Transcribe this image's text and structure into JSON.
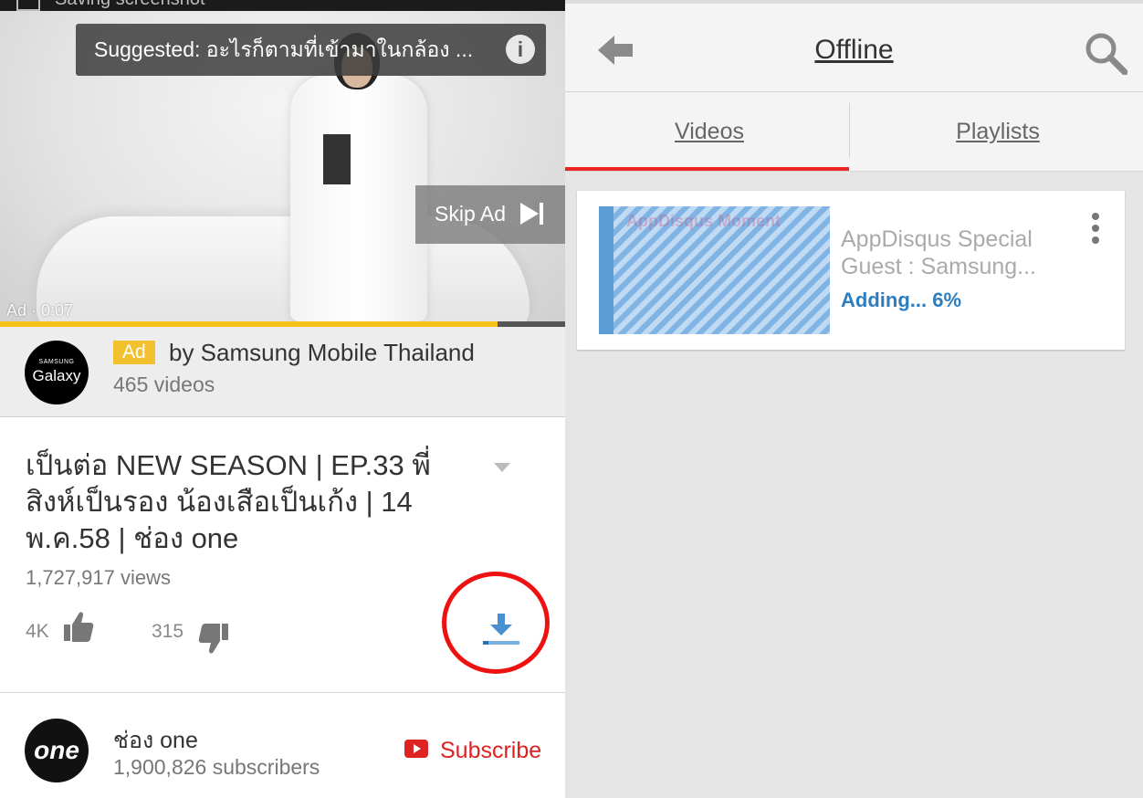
{
  "left_panel": {
    "status_bar": {
      "text": "Saving screenshot"
    },
    "video": {
      "suggestion": "Suggested: อะไรก็ตามที่เข้ามาในกล้อง ...",
      "info_icon": "i",
      "skip_ad": "Skip Ad",
      "ad_time": "Ad · 0:07",
      "progress": 0.88,
      "progress_color": "#f4c21b"
    },
    "ad_info": {
      "logo_brand": "SAMSUNG",
      "logo_name": "Galaxy",
      "badge": "Ad",
      "by_text": "by Samsung Mobile Thailand",
      "video_count": "465 videos"
    },
    "title": "เป็นต่อ NEW SEASON | EP.33 พี่สิงห์เป็นรอง น้องเสือเป็นเก้ง | 14 พ.ค.58 | ช่อง one",
    "views": "1,727,917 views",
    "likes": "4K",
    "dislikes": "315",
    "channel": {
      "logo_text": "one",
      "name": "ช่อง one",
      "subscribers": "1,900,826 subscribers",
      "subscribe_label": "Subscribe"
    },
    "highlight_color": "#e11111"
  },
  "right_panel": {
    "header": {
      "title": "Offline"
    },
    "tabs": [
      {
        "label": "Videos",
        "active": true
      },
      {
        "label": "Playlists",
        "active": false
      }
    ],
    "accent_color": "#e22222",
    "video_item": {
      "thumbnail_ghost_text": "AppDisqus Moment",
      "title": "AppDisqus Special Guest : Samsung...",
      "status": "Adding... 6%"
    }
  }
}
